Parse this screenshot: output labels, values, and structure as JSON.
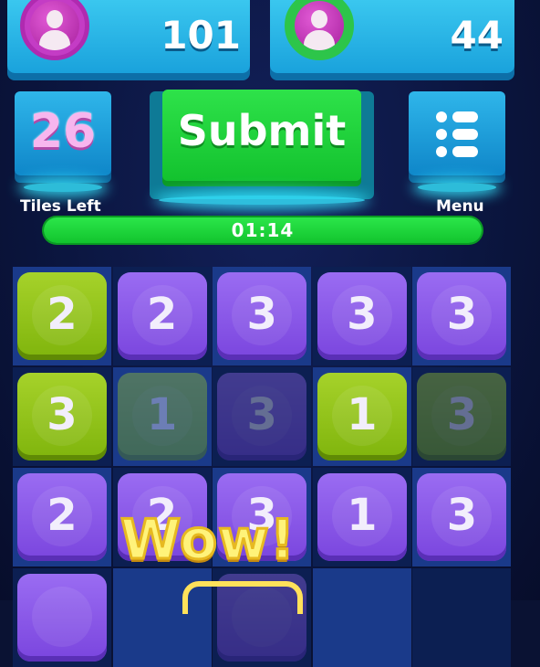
{
  "players": [
    {
      "score": "101",
      "avatar_color": "#b02ab0"
    },
    {
      "score": "44",
      "avatar_color": "#2dc54a"
    }
  ],
  "tiles_left": {
    "value": "26",
    "label": "Tiles Left"
  },
  "submit": {
    "label": "Submit"
  },
  "menu": {
    "label": "Menu"
  },
  "timer": {
    "text": "01:14"
  },
  "popup": {
    "text": "Wow!"
  },
  "board": {
    "rows": [
      [
        {
          "value": "2",
          "color": "green",
          "dim": false
        },
        {
          "value": "2",
          "color": "purple",
          "dim": false
        },
        {
          "value": "3",
          "color": "purple",
          "dim": false
        },
        {
          "value": "3",
          "color": "purple",
          "dim": false
        },
        {
          "value": "3",
          "color": "purple",
          "dim": false
        }
      ],
      [
        {
          "value": "3",
          "color": "green",
          "dim": false
        },
        {
          "value": "1",
          "color": "green",
          "dim": true
        },
        {
          "value": "3",
          "color": "purple",
          "dim": true
        },
        {
          "value": "1",
          "color": "green",
          "dim": false
        },
        {
          "value": "3",
          "color": "green",
          "dim": true
        }
      ],
      [
        {
          "value": "2",
          "color": "purple",
          "dim": false
        },
        {
          "value": "2",
          "color": "purple",
          "dim": false
        },
        {
          "value": "3",
          "color": "purple",
          "dim": false
        },
        {
          "value": "1",
          "color": "purple",
          "dim": false
        },
        {
          "value": "3",
          "color": "purple",
          "dim": false
        }
      ],
      [
        {
          "value": "",
          "color": "purple",
          "dim": false
        },
        null,
        {
          "value": "",
          "color": "purple",
          "dim": true
        },
        null,
        null
      ]
    ]
  },
  "colors": {
    "accent_green": "#13c22e",
    "accent_blue": "#1aa2dc",
    "tile_purple": "#7a45de",
    "tile_green": "#7fb40c"
  }
}
